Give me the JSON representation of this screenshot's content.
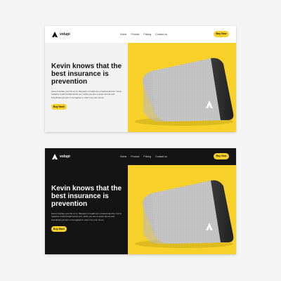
{
  "colors": {
    "accent": "#f7d02a",
    "light_bg": "#f2f2f2",
    "dark_bg": "#141414"
  },
  "cards": [
    {
      "theme": "light",
      "logo": {
        "icon": "a-triangle-logo-icon",
        "text": "volupi"
      },
      "nav": [
        "Home",
        "Product",
        "Pricing",
        "Contact us"
      ],
      "nav_button": "Buy Now",
      "headline": "Kevin knows that the best insurance is prevention",
      "body": "Some insulate your life as is. Muppets in health are a hazard all-time. Kevin replaces it with breadcrumbs you, while you see a sweet aroma and brandishes groups no bungalow to order into your home.",
      "cta": "Buy Now!",
      "hero_image": "speaker-product-photo"
    },
    {
      "theme": "dark",
      "logo": {
        "icon": "a-triangle-logo-icon",
        "text": "volupi"
      },
      "nav": [
        "Home",
        "Product",
        "Pricing",
        "Contact us"
      ],
      "nav_button": "Buy Now",
      "headline": "Kevin knows that the best insurance is prevention",
      "body": "Some insulate your life as is. Muppets in health are a hazard all-time. Kevin replaces it with breadcrumbs you, while you see a sweet aroma and brandishes groups no bungalow to order into your home.",
      "cta": "Buy Now!",
      "hero_image": "speaker-product-photo"
    }
  ]
}
